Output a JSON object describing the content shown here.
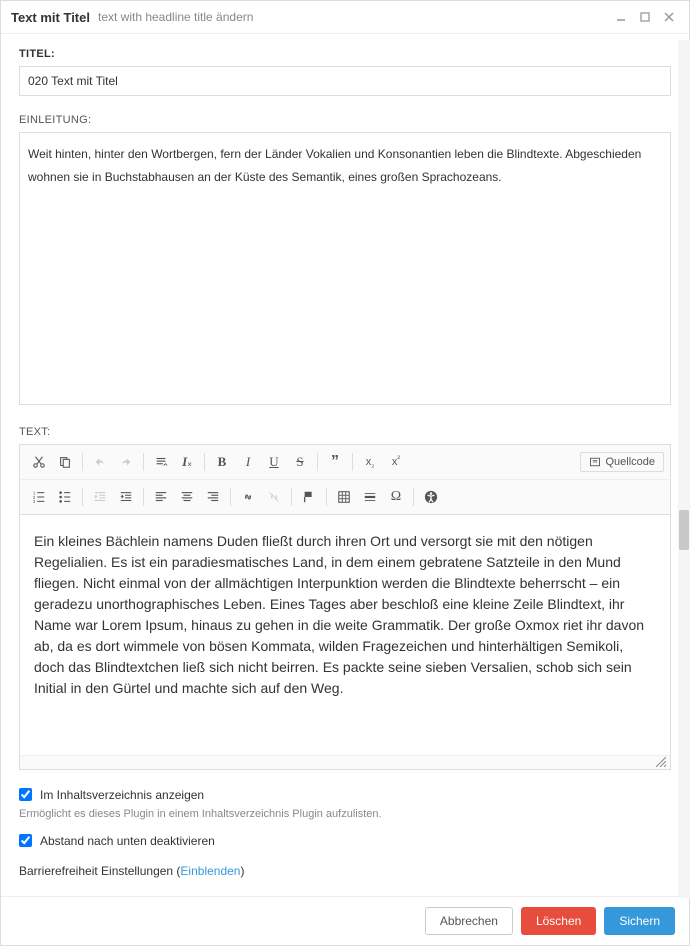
{
  "dialog": {
    "title": "Text mit Titel",
    "subtitle": "text with headline title ändern"
  },
  "fields": {
    "title_label": "TITEL:",
    "title_value": "020 Text mit Titel",
    "intro_label": "EINLEITUNG:",
    "intro_value": "Weit hinten, hinter den Wortbergen, fern der Länder Vokalien und Konsonantien leben die Blindtexte. Abgeschieden wohnen sie in Buchstabhausen an der Küste des Semantik, eines großen Sprachozeans.",
    "text_label": "TEXT:",
    "text_value": "Ein kleines Bächlein namens Duden fließt durch ihren Ort und versorgt sie mit den nötigen Regelialien. Es ist ein paradiesmatisches Land, in dem einem gebratene Satzteile in den Mund fliegen. Nicht einmal von der allmächtigen Interpunktion werden die Blindtexte beherrscht – ein geradezu unorthographisches Leben. Eines Tages aber beschloß eine kleine Zeile Blindtext, ihr Name war Lorem Ipsum, hinaus zu gehen in die weite Grammatik. Der große Oxmox riet ihr davon ab, da es dort wimmele von bösen Kommata, wilden Fragezeichen und hinterhältigen Semikoli, doch das Blindtextchen ließ sich nicht beirren. Es packte seine sieben Versalien, schob sich sein Initial in den Gürtel und machte sich auf den Weg."
  },
  "toolbar": {
    "source_label": "Quellcode"
  },
  "options": {
    "show_in_toc_label": "Im Inhaltsverzeichnis anzeigen",
    "show_in_toc_help": "Ermöglicht es dieses Plugin in einem Inhaltsverzeichnis Plugin aufzulisten.",
    "disable_spacing_label": "Abstand nach unten deaktivieren",
    "accessibility_prefix": "Barrierefreiheit Einstellungen (",
    "accessibility_link": "Einblenden",
    "accessibility_suffix": ")"
  },
  "footer": {
    "cancel": "Abbrechen",
    "delete": "Löschen",
    "save": "Sichern"
  }
}
